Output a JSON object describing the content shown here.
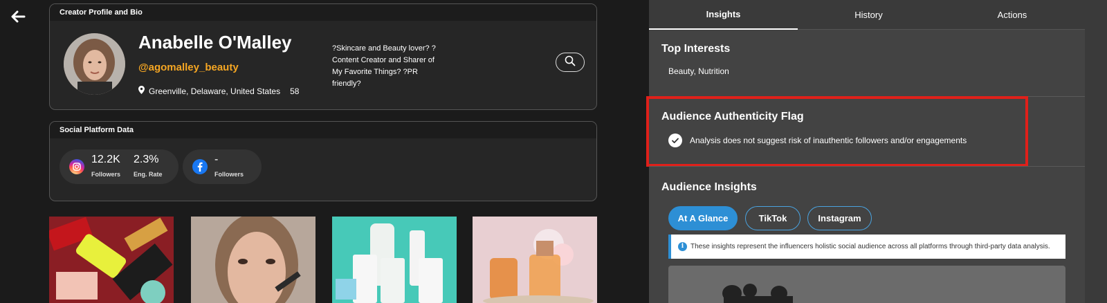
{
  "profile": {
    "card_title": "Creator Profile and Bio",
    "name": "Anabelle O'Malley",
    "handle": "@agomalley_beauty",
    "location": "Greenville, Delaware, United States",
    "age": "58",
    "bio": "?Skincare and Beauty lover? ?Content Creator and Sharer of My Favorite Things? ?PR friendly?"
  },
  "social": {
    "card_title": "Social Platform Data",
    "instagram": {
      "followers": "12.2K",
      "followers_label": "Followers",
      "eng_rate": "2.3%",
      "eng_rate_label": "Eng. Rate"
    },
    "facebook": {
      "followers": "-",
      "followers_label": "Followers"
    }
  },
  "panel": {
    "tabs": [
      {
        "label": "Insights",
        "active": true
      },
      {
        "label": "History",
        "active": false
      },
      {
        "label": "Actions",
        "active": false
      }
    ],
    "top_interests": {
      "title": "Top Interests",
      "text": "Beauty, Nutrition"
    },
    "authenticity": {
      "title": "Audience Authenticity Flag",
      "text": "Analysis does not suggest risk of inauthentic followers and/or engagements"
    },
    "audience_insights": {
      "title": "Audience Insights",
      "chips": [
        {
          "label": "At A Glance",
          "active": true
        },
        {
          "label": "TikTok",
          "active": false
        },
        {
          "label": "Instagram",
          "active": false
        }
      ],
      "info": "These insights represent the influencers holistic social audience across all platforms through third-party data analysis."
    }
  },
  "colors": {
    "handle": "#f5a623",
    "accent": "#2d8fd5",
    "flag_border": "#e0201a",
    "panel_bg": "#434343"
  },
  "icons": [
    "back-arrow-icon",
    "location-pin-icon",
    "search-icon",
    "instagram-icon",
    "facebook-icon",
    "check-icon",
    "info-icon"
  ]
}
